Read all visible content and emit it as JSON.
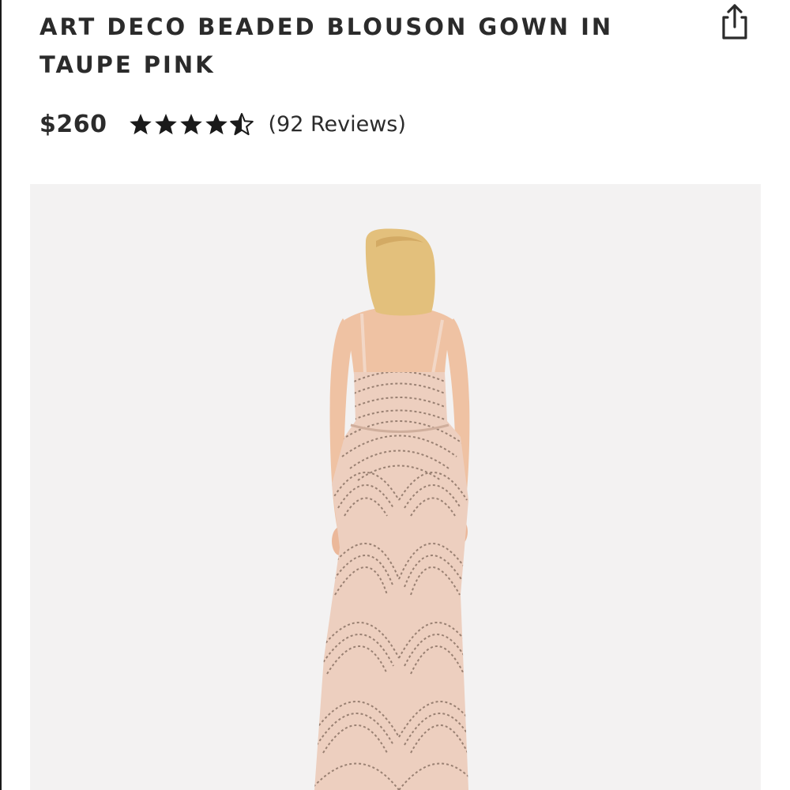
{
  "product": {
    "title": "ART DECO BEADED BLOUSON GOWN IN TAUPE PINK",
    "price": "$260",
    "rating": 4.5,
    "rating_max": 5,
    "reviews_text": "(92 Reviews)"
  },
  "icons": {
    "share": "share-icon",
    "star_full": "star-full-icon",
    "star_half": "star-half-icon"
  },
  "colors": {
    "text": "#2b2b2b",
    "image_bg": "#f3f2f2",
    "gown": "#edcfbf",
    "beading": "#7d6658",
    "hair": "#e3c07c",
    "skin": "#efc2a3"
  }
}
